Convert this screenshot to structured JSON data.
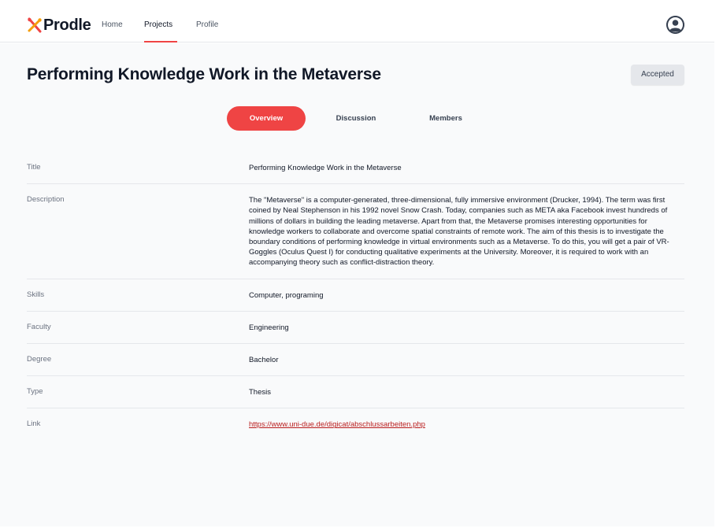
{
  "app": {
    "name": "Prodle",
    "brand_color": "#ef4444"
  },
  "nav": {
    "links": [
      {
        "label": "Home",
        "active": false
      },
      {
        "label": "Projects",
        "active": true
      },
      {
        "label": "Profile",
        "active": false
      }
    ],
    "avatar_icon": "user-avatar-icon"
  },
  "page": {
    "title": "Performing Knowledge Work in the Metaverse",
    "status": "Accepted"
  },
  "tabs": [
    {
      "label": "Overview",
      "active": true
    },
    {
      "label": "Discussion",
      "active": false
    },
    {
      "label": "Members",
      "active": false
    }
  ],
  "details": {
    "title": {
      "label": "Title",
      "value": "Performing Knowledge Work in the Metaverse"
    },
    "description": {
      "label": "Description",
      "value": "The \"Metaverse\" is a computer-generated, three-dimensional, fully immersive environment (Drucker, 1994). The term was first coined by Neal Stephenson in his 1992 novel Snow Crash. Today, companies such as META aka Facebook invest hundreds of millions of dollars in building the leading metaverse. Apart from that, the Metaverse promises interesting opportunities for knowledge workers to collaborate and overcome spatial constraints of remote work. The aim of this thesis is to investigate the boundary conditions of performing knowledge in virtual environments such as a Metaverse. To do this, you will get a pair of VR-Goggles (Oculus Quest I) for conducting qualitative experiments at the University. Moreover, it is required to work with an accompanying theory such as conflict-distraction theory."
    },
    "skills": {
      "label": "Skills",
      "value": "Computer, programing"
    },
    "faculty": {
      "label": "Faculty",
      "value": "Engineering"
    },
    "degree": {
      "label": "Degree",
      "value": "Bachelor"
    },
    "type": {
      "label": "Type",
      "value": "Thesis"
    },
    "link": {
      "label": "Link",
      "value": "https://www.uni-due.de/digicat/abschlussarbeiten.php"
    }
  }
}
